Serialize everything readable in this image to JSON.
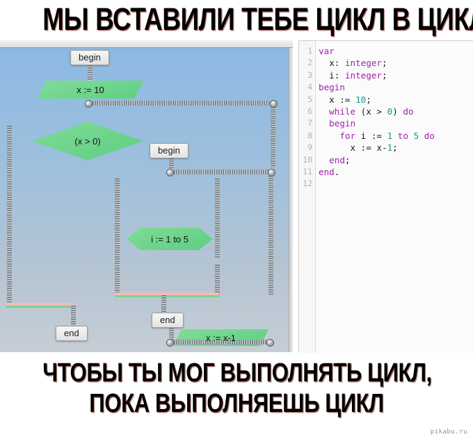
{
  "meme": {
    "top_caption": "МЫ ВСТАВИЛИ ТЕБЕ ЦИКЛ В ЦИКЛ",
    "bottom_caption_line1": "ЧТОБЫ ТЫ МОГ ВЫПОЛНЯТЬ ЦИКЛ,",
    "bottom_caption_line2": "ПОКА ВЫПОЛНЯЕШЬ ЦИКЛ",
    "watermark": "pikabu.ru"
  },
  "code_editor": {
    "line_numbers": [
      "1",
      "2",
      "3",
      "4",
      "5",
      "6",
      "7",
      "8",
      "9",
      "10",
      "11",
      "12"
    ],
    "lines": [
      {
        "n": "1",
        "tokens": [
          {
            "t": "var",
            "c": "kw"
          }
        ]
      },
      {
        "n": "2",
        "tokens": [
          {
            "t": "  x: ",
            "c": "pl"
          },
          {
            "t": "integer",
            "c": "ty"
          },
          {
            "t": ";",
            "c": "pl"
          }
        ]
      },
      {
        "n": "3",
        "tokens": [
          {
            "t": "  i: ",
            "c": "pl"
          },
          {
            "t": "integer",
            "c": "ty"
          },
          {
            "t": ";",
            "c": "pl"
          }
        ]
      },
      {
        "n": "4",
        "tokens": [
          {
            "t": "begin",
            "c": "kw"
          }
        ]
      },
      {
        "n": "5",
        "tokens": [
          {
            "t": "  x := ",
            "c": "pl"
          },
          {
            "t": "10",
            "c": "num"
          },
          {
            "t": ";",
            "c": "pl"
          }
        ]
      },
      {
        "n": "6",
        "tokens": [
          {
            "t": "  ",
            "c": "pl"
          },
          {
            "t": "while",
            "c": "kw"
          },
          {
            "t": " (x > ",
            "c": "pl"
          },
          {
            "t": "0",
            "c": "num"
          },
          {
            "t": ") ",
            "c": "pl"
          },
          {
            "t": "do",
            "c": "kw"
          }
        ]
      },
      {
        "n": "7",
        "tokens": [
          {
            "t": "  ",
            "c": "pl"
          },
          {
            "t": "begin",
            "c": "kw"
          }
        ]
      },
      {
        "n": "8",
        "tokens": [
          {
            "t": "    ",
            "c": "pl"
          },
          {
            "t": "for",
            "c": "kw"
          },
          {
            "t": " i := ",
            "c": "pl"
          },
          {
            "t": "1",
            "c": "num"
          },
          {
            "t": " ",
            "c": "pl"
          },
          {
            "t": "to",
            "c": "kw"
          },
          {
            "t": " ",
            "c": "pl"
          },
          {
            "t": "5",
            "c": "num"
          },
          {
            "t": " ",
            "c": "pl"
          },
          {
            "t": "do",
            "c": "kw"
          }
        ]
      },
      {
        "n": "9",
        "tokens": [
          {
            "t": "      x := x-",
            "c": "pl"
          },
          {
            "t": "1",
            "c": "num"
          },
          {
            "t": ";",
            "c": "pl"
          }
        ]
      },
      {
        "n": "10",
        "tokens": [
          {
            "t": "  ",
            "c": "pl"
          },
          {
            "t": "end",
            "c": "kw"
          },
          {
            "t": ";",
            "c": "pl"
          }
        ]
      },
      {
        "n": "11",
        "tokens": [
          {
            "t": "end",
            "c": "kw"
          },
          {
            "t": ".",
            "c": "pl"
          }
        ]
      },
      {
        "n": "12",
        "tokens": []
      }
    ],
    "colors": {
      "keyword": "#a020b0",
      "type": "#a020b0",
      "number": "#14998c",
      "plain": "#1a1a1a",
      "gutter_text": "#b3b3b3",
      "background": "#fbfbfb"
    }
  },
  "flowchart": {
    "colors": {
      "node_fill": "#6fd48c",
      "node_accent": "#f7b9bb",
      "terminator_fill": "#eeeeee",
      "canvas_top": "#8cb9e2",
      "canvas_bottom": "#c6ced5"
    },
    "nodes": {
      "begin_outer": "begin",
      "assign_x10": "x := 10",
      "cond_x_gt_0": "(x > 0)",
      "begin_inner": "begin",
      "for_i": "i := 1 to 5",
      "assign_x_dec": "x := x-1",
      "end_inner": "end",
      "end_outer": "end"
    }
  }
}
